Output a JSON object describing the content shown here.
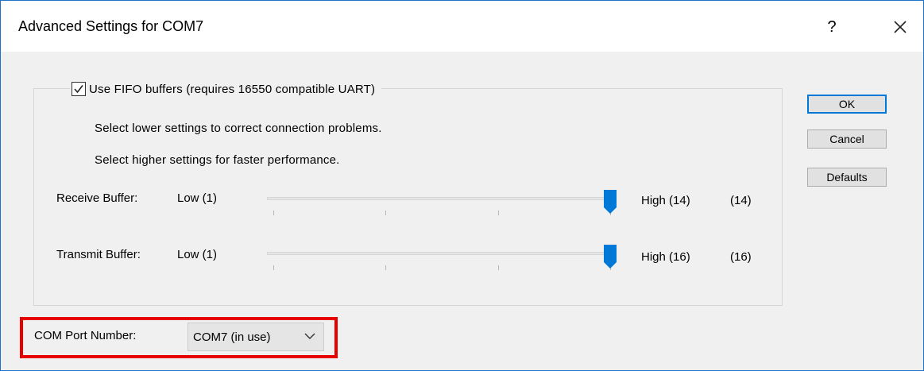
{
  "window": {
    "title": "Advanced Settings for COM7",
    "help_label": "?",
    "close_icon": "close-icon"
  },
  "fifo": {
    "checkbox_label": "Use FIFO buffers (requires 16550 compatible UART)",
    "checked": true,
    "hint_lower": "Select lower settings to correct connection problems.",
    "hint_higher": "Select higher settings for faster performance."
  },
  "receive": {
    "label": "Receive Buffer:",
    "low_label": "Low (1)",
    "high_label": "High (14)",
    "value_label": "(14)",
    "min": 1,
    "max": 14,
    "value": 14
  },
  "transmit": {
    "label": "Transmit Buffer:",
    "low_label": "Low (1)",
    "high_label": "High (16)",
    "value_label": "(16)",
    "min": 1,
    "max": 16,
    "value": 16
  },
  "buttons": {
    "ok": "OK",
    "cancel": "Cancel",
    "defaults": "Defaults"
  },
  "com_port": {
    "label": "COM Port Number:",
    "selected": "COM7 (in use)"
  },
  "colors": {
    "accent": "#0078d7",
    "highlight": "#e60000"
  }
}
